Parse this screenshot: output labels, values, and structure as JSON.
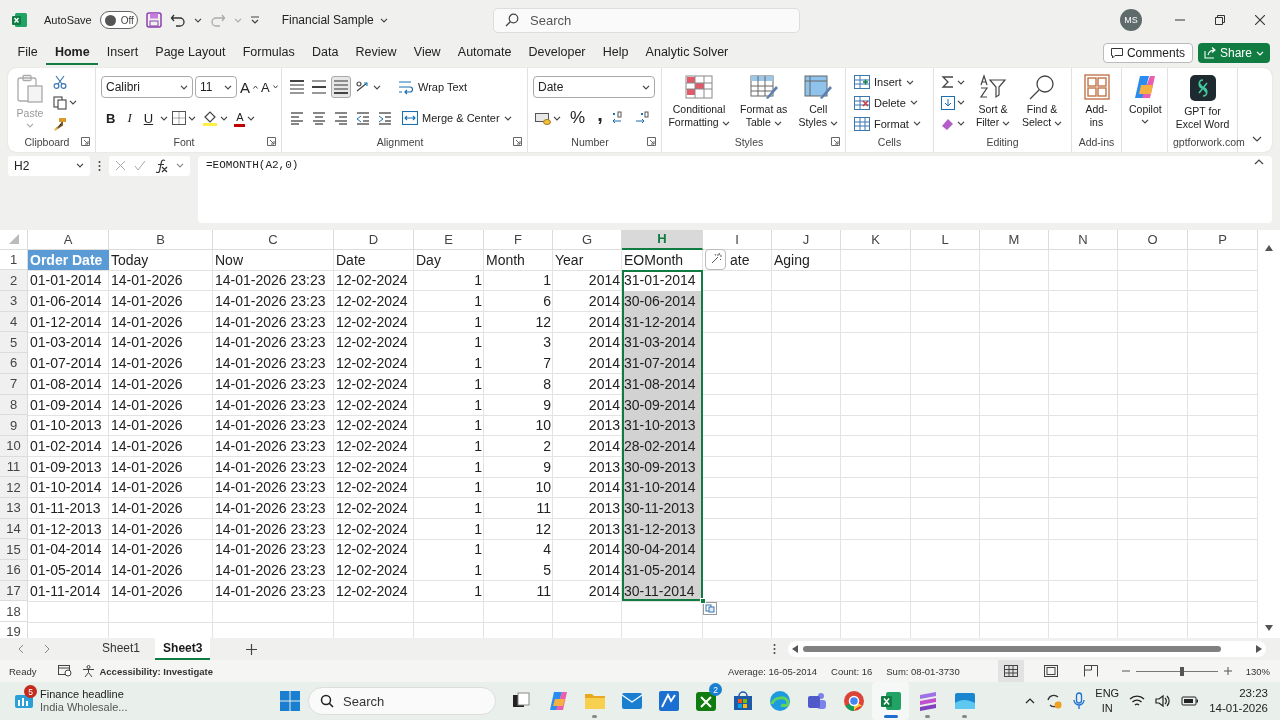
{
  "title_bar": {
    "autosave_label": "AutoSave",
    "autosave": {
      "on": false,
      "label": "Off"
    },
    "document_title": "Financial Sample",
    "search": {
      "placeholder": "Search"
    },
    "avatar": "MS"
  },
  "menu": {
    "tabs": [
      {
        "label": "File",
        "selected": false
      },
      {
        "label": "Home",
        "selected": true
      },
      {
        "label": "Insert",
        "selected": false
      },
      {
        "label": "Page Layout",
        "selected": false
      },
      {
        "label": "Formulas",
        "selected": false
      },
      {
        "label": "Data",
        "selected": false
      },
      {
        "label": "Review",
        "selected": false
      },
      {
        "label": "View",
        "selected": false
      },
      {
        "label": "Automate",
        "selected": false
      },
      {
        "label": "Developer",
        "selected": false
      },
      {
        "label": "Help",
        "selected": false
      },
      {
        "label": "Analytic Solver",
        "selected": false
      }
    ],
    "comments": "Comments",
    "share": "Share"
  },
  "ribbon": {
    "groups": [
      {
        "kind": "clipboard",
        "label": "Clipboard",
        "paste": {
          "label": "Paste",
          "disabled": true
        }
      },
      {
        "kind": "font",
        "label": "Font",
        "font_name": "Calibri",
        "font_size": "11",
        "grow": "A",
        "shrink": "A",
        "bold": "B",
        "italic": "I",
        "underline": "U",
        "font_color": "A"
      },
      {
        "kind": "alignment",
        "label": "Alignment",
        "wrap_text": "Wrap Text",
        "merge": "Merge & Center",
        "vertical_align": [
          {
            "kind": "top",
            "selected": false
          },
          {
            "kind": "middle",
            "selected": false
          },
          {
            "kind": "bottom",
            "selected": true
          }
        ]
      },
      {
        "kind": "number",
        "label": "Number",
        "format": "Date",
        "percent": "%",
        "comma": ","
      },
      {
        "kind": "styles",
        "label": "Styles",
        "buttons": [
          {
            "kind": "conditional",
            "label": "Conditional Formatting"
          },
          {
            "kind": "table",
            "label": "Format as Table"
          },
          {
            "kind": "cell_styles",
            "label": "Cell Styles"
          }
        ]
      },
      {
        "kind": "cells",
        "label": "Cells",
        "buttons": [
          {
            "kind": "insert",
            "label": "Insert"
          },
          {
            "kind": "delete",
            "label": "Delete"
          },
          {
            "kind": "format",
            "label": "Format"
          }
        ]
      },
      {
        "kind": "editing",
        "label": "Editing",
        "buttons": [
          {
            "kind": "sort",
            "label": "Sort & Filter"
          },
          {
            "kind": "find",
            "label": "Find & Select"
          }
        ]
      },
      {
        "kind": "addins",
        "label": "Add-ins",
        "button": "Add-ins"
      },
      {
        "kind": "copilot",
        "button": "Copilot"
      },
      {
        "kind": "gpt",
        "label": "gptforwork.com",
        "button": "GPT for Excel Word"
      }
    ]
  },
  "formula_bar": {
    "name_box": "H2",
    "formula": "=EOMONTH(A2,0)"
  },
  "sheet": {
    "columns": [
      {
        "label": "A",
        "kind": "text",
        "selected": false
      },
      {
        "label": "B",
        "kind": "text",
        "selected": false
      },
      {
        "label": "C",
        "kind": "text",
        "selected": false
      },
      {
        "label": "D",
        "kind": "text",
        "selected": false
      },
      {
        "label": "E",
        "kind": "number",
        "selected": false
      },
      {
        "label": "F",
        "kind": "number",
        "selected": false
      },
      {
        "label": "G",
        "kind": "number",
        "selected": false
      },
      {
        "label": "H",
        "kind": "text",
        "selected": true
      },
      {
        "label": "I",
        "kind": "text",
        "selected": false
      },
      {
        "label": "J",
        "kind": "text",
        "selected": false
      },
      {
        "label": "K",
        "kind": "text",
        "selected": false
      },
      {
        "label": "L",
        "kind": "text",
        "selected": false
      },
      {
        "label": "M",
        "kind": "text",
        "selected": false
      },
      {
        "label": "N",
        "kind": "text",
        "selected": false
      },
      {
        "label": "O",
        "kind": "text",
        "selected": false
      },
      {
        "label": "P",
        "kind": "text",
        "selected": false
      }
    ],
    "header_row": {
      "number": "1",
      "cells": [
        {
          "text": "Order Date",
          "filled": true
        },
        {
          "text": "Today",
          "filled": false
        },
        {
          "text": "Now",
          "filled": false
        },
        {
          "text": "Date",
          "filled": false
        },
        {
          "text": "Day",
          "filled": false
        },
        {
          "text": "Month",
          "filled": false
        },
        {
          "text": "Year",
          "filled": false
        },
        {
          "text": "EOMonth",
          "filled": false
        },
        {
          "text": "ate",
          "filled": false
        },
        {
          "text": "Aging",
          "filled": false
        }
      ]
    },
    "rows": [
      {
        "number": "2",
        "selected": true,
        "cells": [
          "01-01-2014",
          "14-01-2026",
          "14-01-2026 23:23",
          "12-02-2024",
          "1",
          "1",
          "2014",
          "31-01-2014"
        ]
      },
      {
        "number": "3",
        "selected": true,
        "cells": [
          "01-06-2014",
          "14-01-2026",
          "14-01-2026 23:23",
          "12-02-2024",
          "1",
          "6",
          "2014",
          "30-06-2014"
        ]
      },
      {
        "number": "4",
        "selected": true,
        "cells": [
          "01-12-2014",
          "14-01-2026",
          "14-01-2026 23:23",
          "12-02-2024",
          "1",
          "12",
          "2014",
          "31-12-2014"
        ]
      },
      {
        "number": "5",
        "selected": true,
        "cells": [
          "01-03-2014",
          "14-01-2026",
          "14-01-2026 23:23",
          "12-02-2024",
          "1",
          "3",
          "2014",
          "31-03-2014"
        ]
      },
      {
        "number": "6",
        "selected": true,
        "cells": [
          "01-07-2014",
          "14-01-2026",
          "14-01-2026 23:23",
          "12-02-2024",
          "1",
          "7",
          "2014",
          "31-07-2014"
        ]
      },
      {
        "number": "7",
        "selected": true,
        "cells": [
          "01-08-2014",
          "14-01-2026",
          "14-01-2026 23:23",
          "12-02-2024",
          "1",
          "8",
          "2014",
          "31-08-2014"
        ]
      },
      {
        "number": "8",
        "selected": true,
        "cells": [
          "01-09-2014",
          "14-01-2026",
          "14-01-2026 23:23",
          "12-02-2024",
          "1",
          "9",
          "2014",
          "30-09-2014"
        ]
      },
      {
        "number": "9",
        "selected": true,
        "cells": [
          "01-10-2013",
          "14-01-2026",
          "14-01-2026 23:23",
          "12-02-2024",
          "1",
          "10",
          "2013",
          "31-10-2013"
        ]
      },
      {
        "number": "10",
        "selected": true,
        "cells": [
          "01-02-2014",
          "14-01-2026",
          "14-01-2026 23:23",
          "12-02-2024",
          "1",
          "2",
          "2014",
          "28-02-2014"
        ]
      },
      {
        "number": "11",
        "selected": true,
        "cells": [
          "01-09-2013",
          "14-01-2026",
          "14-01-2026 23:23",
          "12-02-2024",
          "1",
          "9",
          "2013",
          "30-09-2013"
        ]
      },
      {
        "number": "12",
        "selected": true,
        "cells": [
          "01-10-2014",
          "14-01-2026",
          "14-01-2026 23:23",
          "12-02-2024",
          "1",
          "10",
          "2014",
          "31-10-2014"
        ]
      },
      {
        "number": "13",
        "selected": true,
        "cells": [
          "01-11-2013",
          "14-01-2026",
          "14-01-2026 23:23",
          "12-02-2024",
          "1",
          "11",
          "2013",
          "30-11-2013"
        ]
      },
      {
        "number": "14",
        "selected": true,
        "cells": [
          "01-12-2013",
          "14-01-2026",
          "14-01-2026 23:23",
          "12-02-2024",
          "1",
          "12",
          "2013",
          "31-12-2013"
        ]
      },
      {
        "number": "15",
        "selected": true,
        "cells": [
          "01-04-2014",
          "14-01-2026",
          "14-01-2026 23:23",
          "12-02-2024",
          "1",
          "4",
          "2014",
          "30-04-2014"
        ]
      },
      {
        "number": "16",
        "selected": true,
        "cells": [
          "01-05-2014",
          "14-01-2026",
          "14-01-2026 23:23",
          "12-02-2024",
          "1",
          "5",
          "2014",
          "31-05-2014"
        ]
      },
      {
        "number": "17",
        "selected": true,
        "cells": [
          "01-11-2014",
          "14-01-2026",
          "14-01-2026 23:23",
          "12-02-2024",
          "1",
          "11",
          "2014",
          "30-11-2014"
        ]
      },
      {
        "number": "18",
        "selected": false
      },
      {
        "number": "19",
        "selected": false
      }
    ]
  },
  "sheet_tabs": [
    {
      "label": "Sheet1",
      "selected": false
    },
    {
      "label": "Sheet3",
      "selected": true
    }
  ],
  "status_bar": {
    "ready": "Ready",
    "accessibility": "Accessibility: Investigate",
    "average": "Average: 16-05-2014",
    "count": "Count: 16",
    "sum": "Sum: 08-01-3730",
    "views": [
      {
        "kind": "normal",
        "selected": true
      },
      {
        "kind": "page_layout",
        "selected": false
      },
      {
        "kind": "page_break",
        "selected": false
      }
    ],
    "zoom": {
      "level": 0.57,
      "reading": "130%"
    }
  },
  "taskbar": {
    "widget": {
      "title": "Finance headline",
      "subtitle": "India Wholesale...",
      "badge": "5"
    },
    "search": {
      "placeholder": "Search"
    },
    "apps": [
      {
        "kind": "task_view",
        "running": false,
        "selected": false
      },
      {
        "kind": "copilot",
        "running": false,
        "selected": false
      },
      {
        "kind": "files",
        "running": true,
        "selected": false
      },
      {
        "kind": "mail",
        "running": false,
        "selected": false
      },
      {
        "kind": "editor",
        "running": false,
        "selected": false
      },
      {
        "kind": "xbox",
        "running": false,
        "selected": false,
        "badge": "2"
      },
      {
        "kind": "store",
        "running": false,
        "selected": false
      },
      {
        "kind": "edge",
        "running": false,
        "selected": false
      },
      {
        "kind": "teams",
        "running": false,
        "selected": false
      },
      {
        "kind": "chrome",
        "running": false,
        "selected": false
      },
      {
        "kind": "excel",
        "running": true,
        "selected": true
      },
      {
        "kind": "stack",
        "running": true,
        "selected": false
      },
      {
        "kind": "photos",
        "running": true,
        "selected": false
      }
    ],
    "tray": {
      "language": "ENG",
      "region": "IN",
      "time": "23:23",
      "date": "14-01-2026"
    }
  }
}
